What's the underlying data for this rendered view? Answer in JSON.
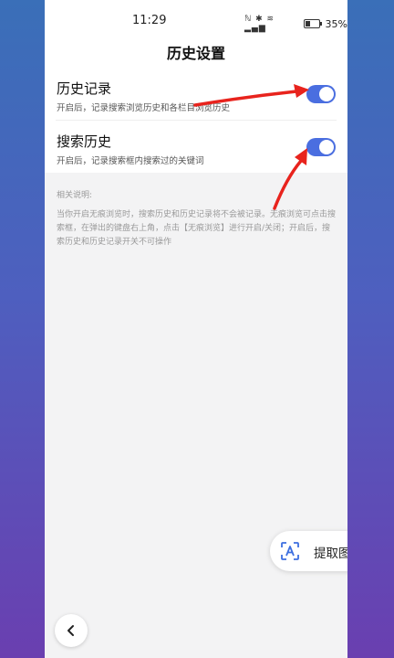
{
  "status_bar": {
    "time": "11:29",
    "icons": "NFC bluetooth wifi signal",
    "battery_percent": "35%"
  },
  "title_bar": {
    "title": "历史设置"
  },
  "settings": [
    {
      "title": "历史记录",
      "description": "开启后，记录搜索浏览历史和各栏目浏览历史",
      "enabled": true
    },
    {
      "title": "搜索历史",
      "description": "开启后，记录搜索框内搜索过的关键词",
      "enabled": true
    }
  ],
  "notes": {
    "heading": "相关说明:",
    "body": "当你开启无痕浏览时，搜索历史和历史记录将不会被记录。无痕浏览可点击搜索框，在弹出的键盘右上角，点击【无痕浏览】进行开启/关闭；开启后，搜索历史和历史记录开关不可操作"
  },
  "ocr_button": {
    "label": "提取图中文字",
    "icon": "text-recognition-icon"
  },
  "back_button": {
    "icon": "chevron-left-icon"
  },
  "colors": {
    "toggle_on": "#4a6ee0",
    "arrow": "#e8231d"
  }
}
